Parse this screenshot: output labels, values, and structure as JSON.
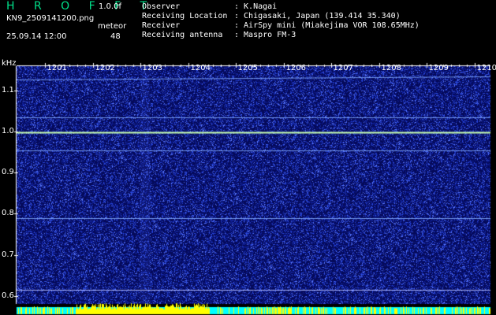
{
  "header": {
    "app_title": "H R O F F T",
    "version": "1.0.0f",
    "filename": "KN9_2509141200.png",
    "datetime": "25.09.14 12:00",
    "meteor_label": "meteor",
    "meteor_count": "48"
  },
  "info": [
    {
      "label": "Observer",
      "value": ": K.Nagai"
    },
    {
      "label": "Receiving Location",
      "value": ": Chigasaki, Japan (139.414 35.340)"
    },
    {
      "label": "Receiver",
      "value": ": AirSpy mini (Miakejima VOR 108.65MHz)"
    },
    {
      "label": "Receiving antenna",
      "value": ": Maspro FM-3"
    }
  ],
  "colors": {
    "background": "#000000",
    "spectrogram_base": "#050a5a",
    "noise_light": "#3c5aff",
    "carrier_line": "#c8ffb0",
    "title_green": "#00e08a",
    "histogram_yellow": "#ffff00",
    "histogram_cyan": "#00ffff"
  },
  "chart_data": {
    "type": "heatmap",
    "y_unit": "kHz",
    "x_ticks": [
      "1201",
      "1202",
      "1203",
      "1204",
      "1205",
      "1206",
      "1207",
      "1208",
      "1209",
      "1210"
    ],
    "y_ticks": [
      "1.1",
      "1.0",
      "0.9",
      "0.8",
      "0.7",
      "0.6"
    ],
    "y_tick_values": [
      1.1,
      1.0,
      0.9,
      0.8,
      0.7,
      0.6
    ],
    "ylim": [
      0.58,
      1.16
    ],
    "horizontal_lines_khz": [
      1.13,
      1.035,
      0.998,
      0.955,
      0.79,
      0.615
    ]
  }
}
